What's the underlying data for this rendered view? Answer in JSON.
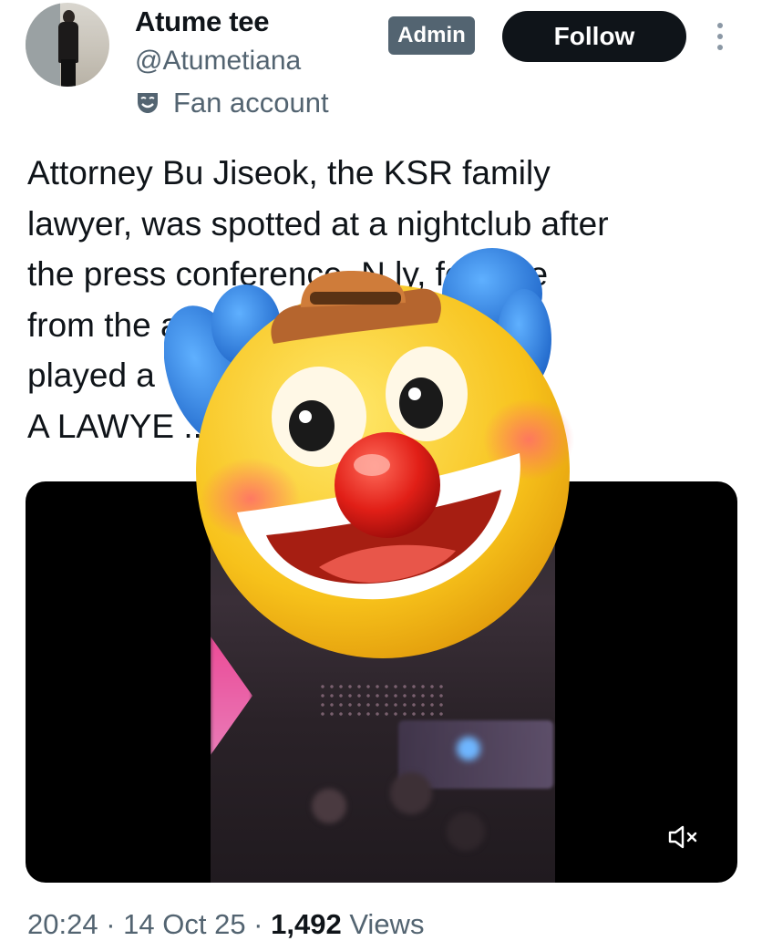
{
  "author": {
    "display_name": "Atume tee",
    "handle": "@Atumetiana",
    "label_icon": "theater-mask-icon",
    "label": "Fan account"
  },
  "badge": {
    "label": "Admin"
  },
  "actions": {
    "follow_label": "Follow",
    "more_icon": "vertical-ellipsis-icon"
  },
  "tweet": {
    "lines": [
      "Attorney Bu Jiseok, the KSR family",
      "lawyer, was spotted at a nightclub after",
      "the press conference. N        ly, footage",
      "from the              as  being",
      "played a",
      "A LAWYE                 ............"
    ]
  },
  "media": {
    "mute_icon": "muted-speaker-icon",
    "overlay": "clown-face-emoji"
  },
  "meta": {
    "time": "20:24",
    "separator": " · ",
    "date": "14 Oct 25",
    "views_count": "1,492",
    "views_label": " Views"
  },
  "colors": {
    "text": "#0f1419",
    "secondary": "#536471",
    "button": "#0f1419",
    "badge": "#536471"
  }
}
